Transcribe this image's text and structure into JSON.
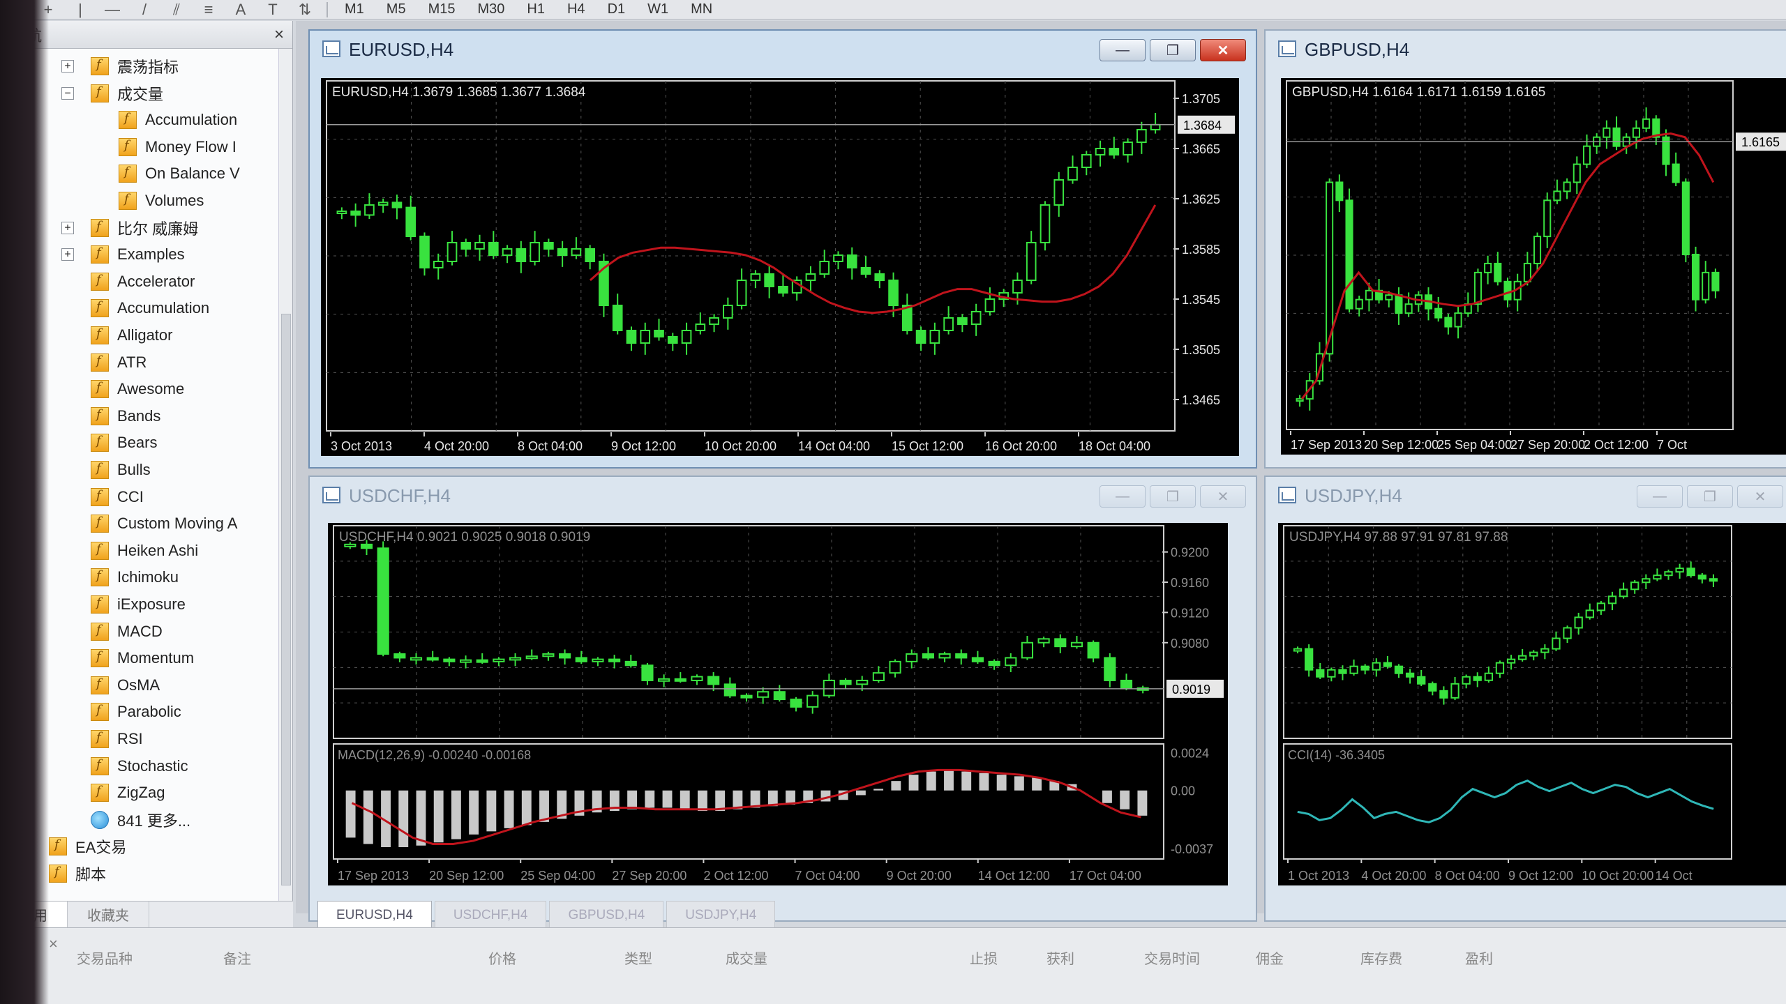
{
  "toolbar": {
    "tools": [
      {
        "icon": "cursor-arrow-icon",
        "glyph": "↖"
      },
      {
        "icon": "crosshair-icon",
        "glyph": "+"
      },
      {
        "icon": "vertical-line-icon",
        "glyph": "|"
      },
      {
        "icon": "horizontal-line-icon",
        "glyph": "—"
      },
      {
        "icon": "trendline-icon",
        "glyph": "/"
      },
      {
        "icon": "equidistant-channel-icon",
        "glyph": "⫽"
      },
      {
        "icon": "fibonacci-icon",
        "glyph": "≡"
      },
      {
        "icon": "text-icon",
        "glyph": "A"
      },
      {
        "icon": "text-label-icon",
        "glyph": "T"
      },
      {
        "icon": "arrows-icon",
        "glyph": "⇅"
      }
    ],
    "timeframes": [
      "M1",
      "M5",
      "M15",
      "M30",
      "H1",
      "H4",
      "D1",
      "W1",
      "MN"
    ]
  },
  "navigator": {
    "title": "导航",
    "items": [
      {
        "label": "震荡指标",
        "level": 1,
        "exp": "+",
        "icon": "indicator-folder-icon"
      },
      {
        "label": "成交量",
        "level": 1,
        "exp": "−",
        "icon": "indicator-folder-icon"
      },
      {
        "label": "Accumulation",
        "level": 2,
        "icon": "indicator-icon"
      },
      {
        "label": "Money Flow I",
        "level": 2,
        "icon": "indicator-icon"
      },
      {
        "label": "On Balance V",
        "level": 2,
        "icon": "indicator-icon"
      },
      {
        "label": "Volumes",
        "level": 2,
        "icon": "indicator-icon"
      },
      {
        "label": "比尔 威廉姆",
        "level": 1,
        "exp": "+",
        "icon": "indicator-folder-icon"
      },
      {
        "label": "Examples",
        "level": 1,
        "exp": "+",
        "icon": "indicator-folder-icon"
      },
      {
        "label": "Accelerator",
        "level": 1,
        "icon": "indicator-icon"
      },
      {
        "label": "Accumulation",
        "level": 1,
        "icon": "indicator-icon"
      },
      {
        "label": "Alligator",
        "level": 1,
        "icon": "indicator-icon"
      },
      {
        "label": "ATR",
        "level": 1,
        "icon": "indicator-icon"
      },
      {
        "label": "Awesome",
        "level": 1,
        "icon": "indicator-icon"
      },
      {
        "label": "Bands",
        "level": 1,
        "icon": "indicator-icon"
      },
      {
        "label": "Bears",
        "level": 1,
        "icon": "indicator-icon"
      },
      {
        "label": "Bulls",
        "level": 1,
        "icon": "indicator-icon"
      },
      {
        "label": "CCI",
        "level": 1,
        "icon": "indicator-icon"
      },
      {
        "label": "Custom Moving A",
        "level": 1,
        "icon": "indicator-icon"
      },
      {
        "label": "Heiken Ashi",
        "level": 1,
        "icon": "indicator-icon"
      },
      {
        "label": "Ichimoku",
        "level": 1,
        "icon": "indicator-icon"
      },
      {
        "label": "iExposure",
        "level": 1,
        "icon": "indicator-icon"
      },
      {
        "label": "MACD",
        "level": 1,
        "icon": "indicator-icon"
      },
      {
        "label": "Momentum",
        "level": 1,
        "icon": "indicator-icon"
      },
      {
        "label": "OsMA",
        "level": 1,
        "icon": "indicator-icon"
      },
      {
        "label": "Parabolic",
        "level": 1,
        "icon": "indicator-icon"
      },
      {
        "label": "RSI",
        "level": 1,
        "icon": "indicator-icon"
      },
      {
        "label": "Stochastic",
        "level": 1,
        "icon": "indicator-icon"
      },
      {
        "label": "ZigZag",
        "level": 1,
        "icon": "indicator-icon"
      },
      {
        "label": "841 更多...",
        "level": 1,
        "icon": "web-globe-icon"
      },
      {
        "label": "EA交易",
        "level": 0,
        "exp": "+",
        "icon": "expert-advisors-icon"
      },
      {
        "label": "脚本",
        "level": 0,
        "exp": "+",
        "icon": "scripts-icon"
      }
    ],
    "tabs": [
      "常用",
      "收藏夹"
    ]
  },
  "windows": [
    {
      "id": "eurusd",
      "title": "EURUSD,H4",
      "info": "EURUSD,H4  1.3679 1.3685 1.3677 1.3684",
      "active": true,
      "dim": false,
      "ymin": 1.345,
      "ymax": 1.371,
      "yticks": [
        "1.3705",
        "1.3665",
        "1.3625",
        "1.3585",
        "1.3545",
        "1.3505",
        "1.3465"
      ],
      "current_price": "1.3684",
      "current_value": 1.3684,
      "xticks": [
        "3 Oct 2013",
        "4 Oct 20:00",
        "8 Oct 04:00",
        "9 Oct 12:00",
        "10 Oct 20:00",
        "14 Oct 04:00",
        "15 Oct 12:00",
        "16 Oct 20:00",
        "18 Oct 04:00"
      ],
      "close": [
        1.3615,
        1.3612,
        1.362,
        1.3622,
        1.3618,
        1.3595,
        1.357,
        1.3575,
        1.359,
        1.3585,
        1.359,
        1.358,
        1.3585,
        1.3575,
        1.359,
        1.3585,
        1.358,
        1.3585,
        1.3575,
        1.354,
        1.352,
        1.351,
        1.352,
        1.3515,
        1.351,
        1.352,
        1.3525,
        1.353,
        1.354,
        1.356,
        1.3565,
        1.3555,
        1.355,
        1.356,
        1.3565,
        1.3575,
        1.358,
        1.357,
        1.3565,
        1.356,
        1.354,
        1.352,
        1.351,
        1.352,
        1.353,
        1.3525,
        1.3535,
        1.3545,
        1.355,
        1.356,
        1.359,
        1.362,
        1.364,
        1.365,
        1.366,
        1.3665,
        1.366,
        1.367,
        1.368,
        1.3684
      ],
      "ma": [
        1.356,
        1.357,
        1.3578,
        1.3582,
        1.3584,
        1.3586,
        1.3586,
        1.3585,
        1.3584,
        1.3583,
        1.3582,
        1.358,
        1.3576,
        1.357,
        1.3562,
        1.3555,
        1.3548,
        1.3542,
        1.3538,
        1.3535,
        1.3534,
        1.3535,
        1.3537,
        1.354,
        1.3545,
        1.355,
        1.3553,
        1.3553,
        1.355,
        1.3547,
        1.3545,
        1.3544,
        1.3543,
        1.3543,
        1.3545,
        1.3549,
        1.3555,
        1.3565,
        1.358,
        1.36,
        1.362
      ],
      "ma_start_index": 18,
      "series_color": "#39e23f",
      "ma_color": "#c0141c"
    },
    {
      "id": "gbpusd",
      "title": "GBPUSD,H4",
      "info": "GBPUSD,H4  1.6164 1.6171 1.6159 1.6165",
      "active": false,
      "dim": false,
      "ymin": 1.586,
      "ymax": 1.622,
      "yticks": [],
      "current_price": "1.6165",
      "current_value": 1.6165,
      "xticks": [
        "17 Sep 2013",
        "20 Sep 12:00",
        "25 Sep 04:00",
        "27 Sep 20:00",
        "2 Oct 12:00",
        "7 Oct"
      ],
      "close": [
        1.588,
        1.59,
        1.593,
        1.612,
        1.61,
        1.598,
        1.599,
        1.6,
        1.599,
        1.5995,
        1.5975,
        1.5985,
        1.5995,
        1.598,
        1.597,
        1.596,
        1.5975,
        1.5985,
        1.602,
        1.603,
        1.601,
        1.599,
        1.601,
        1.603,
        1.606,
        1.61,
        1.611,
        1.612,
        1.614,
        1.616,
        1.617,
        1.618,
        1.616,
        1.617,
        1.618,
        1.619,
        1.617,
        1.614,
        1.612,
        1.604,
        1.599,
        1.602,
        1.6
      ],
      "ma": [
        1.588,
        1.59,
        1.595,
        1.6,
        1.602,
        1.6,
        1.5998,
        1.5994,
        1.599,
        1.5988,
        1.5985,
        1.5983,
        1.5985,
        1.599,
        1.5995,
        1.6,
        1.601,
        1.603,
        1.606,
        1.609,
        1.612,
        1.614,
        1.615,
        1.616,
        1.6168,
        1.6172,
        1.6174,
        1.617,
        1.615,
        1.612
      ],
      "ma_start_index": 0,
      "series_color": "#39e23f",
      "ma_color": "#c0141c"
    },
    {
      "id": "usdchf",
      "title": "USDCHF,H4",
      "info": "USDCHF,H4  0.9021 0.9025 0.9018 0.9019",
      "active": false,
      "dim": true,
      "ymin": 0.897,
      "ymax": 0.922,
      "yticks": [
        "0.9200",
        "0.9160",
        "0.9120",
        "",
        "0.9080"
      ],
      "current_price": "0.9019",
      "current_value": 0.9019,
      "xticks": [
        "17 Sep 2013",
        "20 Sep 12:00",
        "25 Sep 04:00",
        "27 Sep 20:00",
        "2 Oct 12:00",
        "7 Oct 04:00",
        "9 Oct 20:00",
        "14 Oct 12:00",
        "17 Oct 04:00"
      ],
      "close": [
        0.921,
        0.9205,
        0.9065,
        0.906,
        0.906,
        0.9058,
        0.9055,
        0.9057,
        0.9055,
        0.9058,
        0.906,
        0.9062,
        0.9065,
        0.906,
        0.9055,
        0.9058,
        0.9055,
        0.905,
        0.903,
        0.9032,
        0.903,
        0.9035,
        0.9025,
        0.901,
        0.9008,
        0.9015,
        0.9005,
        0.8995,
        0.901,
        0.903,
        0.9025,
        0.903,
        0.904,
        0.9055,
        0.9065,
        0.906,
        0.9065,
        0.906,
        0.9055,
        0.905,
        0.906,
        0.908,
        0.9085,
        0.9075,
        0.908,
        0.906,
        0.903,
        0.902,
        0.9019
      ],
      "ma": [],
      "ma_start_index": 0,
      "series_color": "#39e23f",
      "ma_color": "#c0141c",
      "sub": {
        "label": "MACD(12,26,9) -0.00240 -0.00168",
        "yticks": [
          "0.0024",
          "0.00",
          "-0.0037"
        ],
        "ymin": -0.004,
        "ymax": 0.0026,
        "hist": [
          -0.003,
          -0.0034,
          -0.0036,
          -0.0036,
          -0.0035,
          -0.0033,
          -0.0031,
          -0.0028,
          -0.0026,
          -0.0024,
          -0.0022,
          -0.002,
          -0.0018,
          -0.0016,
          -0.0014,
          -0.0013,
          -0.0012,
          -0.0011,
          -0.0011,
          -0.0012,
          -0.0013,
          -0.0013,
          -0.0012,
          -0.0011,
          -0.001,
          -0.0009,
          -0.0008,
          -0.0007,
          -0.0006,
          -0.0003,
          0.0001,
          0.0006,
          0.001,
          0.0012,
          0.0013,
          0.0012,
          0.0011,
          0.001,
          0.0009,
          0.0008,
          0.0006,
          0.0004,
          0.0,
          -0.0008,
          -0.0012,
          -0.0016
        ],
        "signal": [
          -0.0008,
          -0.0014,
          -0.0022,
          -0.003,
          -0.0034,
          -0.0034,
          -0.0032,
          -0.0028,
          -0.0024,
          -0.002,
          -0.0017,
          -0.0014,
          -0.0012,
          -0.0011,
          -0.0011,
          -0.0012,
          -0.0012,
          -0.0012,
          -0.0012,
          -0.0011,
          -0.001,
          -0.0009,
          -0.0008,
          -0.0006,
          -0.0003,
          0.0001,
          0.0005,
          0.0009,
          0.0012,
          0.0013,
          0.0013,
          0.0012,
          0.0011,
          0.001,
          0.0008,
          0.0005,
          0.0,
          -0.0008,
          -0.0014,
          -0.0017
        ],
        "hist_color": "#c9c9c9",
        "signal_color": "#c0141c"
      }
    },
    {
      "id": "usdjpy",
      "title": "USDJPY,H4",
      "info": "USDJPY,H4  97.88 97.91 97.81 97.88",
      "active": false,
      "dim": true,
      "ymin": 96.5,
      "ymax": 99.2,
      "yticks": [],
      "current_price": "",
      "current_value": null,
      "xticks": [
        "1 Oct 2013",
        "4 Oct 20:00",
        "8 Oct 04:00",
        "9 Oct 12:00",
        "10 Oct 20:00",
        "14 Oct"
      ],
      "close": [
        97.6,
        97.3,
        97.2,
        97.3,
        97.25,
        97.35,
        97.3,
        97.4,
        97.35,
        97.25,
        97.2,
        97.1,
        97.0,
        96.9,
        97.1,
        97.2,
        97.15,
        97.25,
        97.4,
        97.45,
        97.5,
        97.55,
        97.6,
        97.75,
        97.9,
        98.05,
        98.15,
        98.25,
        98.35,
        98.45,
        98.55,
        98.6,
        98.65,
        98.7,
        98.75,
        98.65,
        98.6,
        98.58
      ],
      "ma": [],
      "ma_start_index": 0,
      "series_color": "#39e23f",
      "ma_color": "#c0141c",
      "sub": {
        "label": "CCI(14) -36.3405",
        "yticks": [],
        "ymin": -250,
        "ymax": 250,
        "line": [
          -50,
          -60,
          -90,
          -80,
          -40,
          10,
          -30,
          -80,
          -60,
          -50,
          -70,
          -90,
          -100,
          -80,
          -40,
          20,
          60,
          40,
          20,
          40,
          80,
          100,
          70,
          50,
          70,
          90,
          60,
          40,
          60,
          80,
          70,
          40,
          20,
          40,
          60,
          30,
          0,
          -20,
          -36
        ],
        "line_color": "#2fb7b7"
      }
    }
  ],
  "chart_tabs": [
    "EURUSD,H4",
    "USDCHF,H4",
    "GBPUSD,H4",
    "USDJPY,H4"
  ],
  "window_buttons": {
    "minimize": "—",
    "restore": "❐",
    "close": "✕"
  },
  "terminal": {
    "headers": [
      "交易品种",
      "备注",
      "价格",
      "类型",
      "成交量",
      "止损",
      "获利",
      "交易时间",
      "佣金",
      "库存费",
      "盈利"
    ]
  }
}
